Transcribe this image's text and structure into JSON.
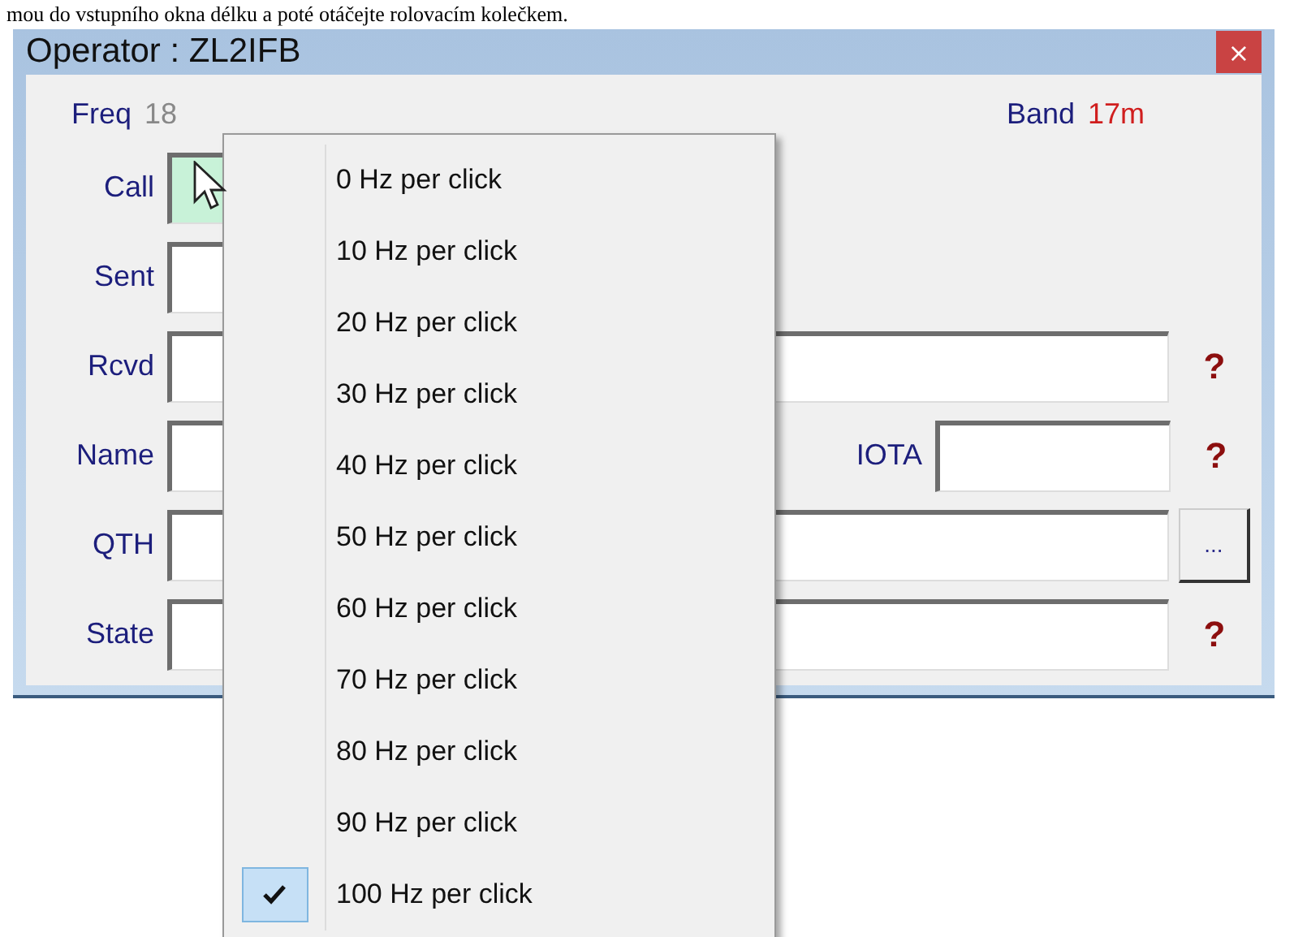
{
  "document_text": "mou do vstupního okna délku a poté otáčejte rolovacím kolečkem.",
  "window": {
    "title": "Operator : ZL2IFB",
    "close": "×"
  },
  "header": {
    "freq_label": "Freq",
    "freq_value": "18",
    "band_label": "Band",
    "band_value": "17m"
  },
  "fields": [
    {
      "label": "Call",
      "highlighted": true,
      "kind": "short"
    },
    {
      "label": "Sent",
      "highlighted": false,
      "kind": "short"
    },
    {
      "label": "Rcvd",
      "highlighted": false,
      "kind": "full",
      "suffix": {
        "kind": "help",
        "text": "?"
      }
    },
    {
      "label": "Name",
      "highlighted": false,
      "kind": "short",
      "extra": {
        "label": "IOTA"
      },
      "suffix": {
        "kind": "help",
        "text": "?"
      }
    },
    {
      "label": "QTH",
      "highlighted": false,
      "kind": "full",
      "suffix": {
        "kind": "button",
        "text": "..."
      }
    },
    {
      "label": "State",
      "highlighted": false,
      "kind": "full",
      "suffix": {
        "kind": "help",
        "text": "?"
      }
    }
  ],
  "menu": {
    "items": [
      {
        "label": "0 Hz per click",
        "checked": false
      },
      {
        "label": "10 Hz per click",
        "checked": false
      },
      {
        "label": "20 Hz per click",
        "checked": false
      },
      {
        "label": "30 Hz per click",
        "checked": false
      },
      {
        "label": "40 Hz per click",
        "checked": false
      },
      {
        "label": "50 Hz per click",
        "checked": false
      },
      {
        "label": "60 Hz per click",
        "checked": false
      },
      {
        "label": "70 Hz per click",
        "checked": false
      },
      {
        "label": "80 Hz per click",
        "checked": false
      },
      {
        "label": "90 Hz per click",
        "checked": false
      },
      {
        "label": "100 Hz per click",
        "checked": true
      }
    ]
  }
}
